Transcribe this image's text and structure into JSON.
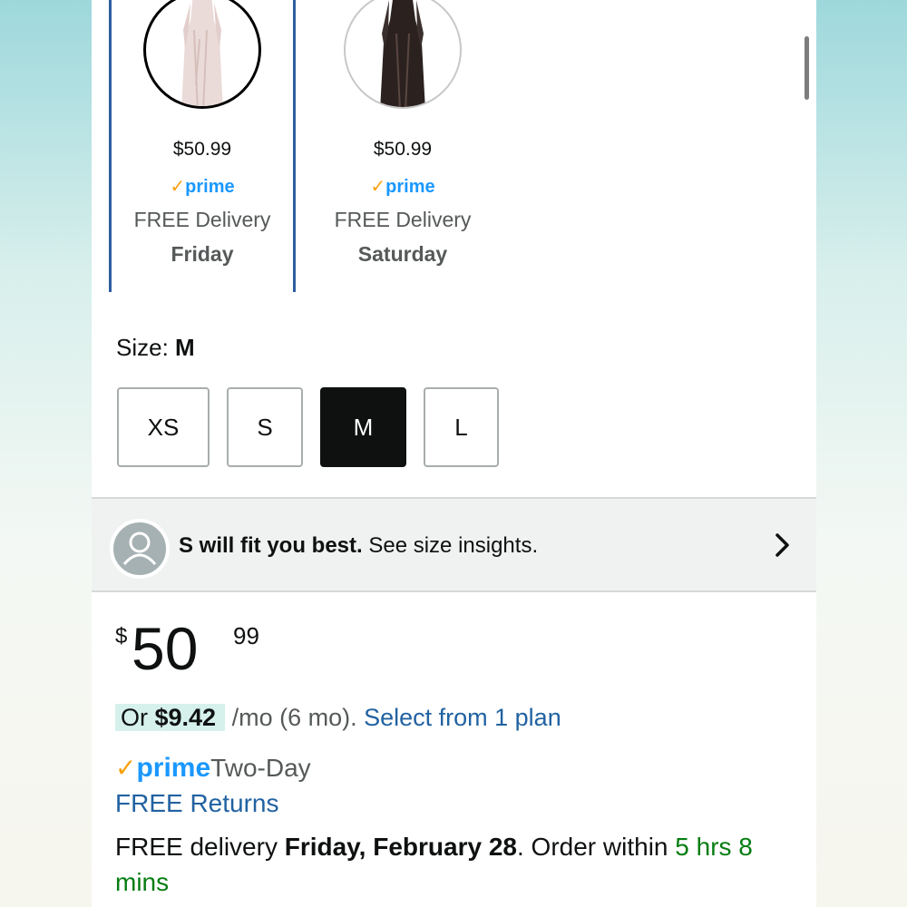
{
  "swatches": [
    {
      "name": "white-lace",
      "price": "$50.99",
      "prime_check": "✓",
      "prime": "prime",
      "delivery": "FREE Delivery",
      "day": "Friday",
      "selected": true
    },
    {
      "name": "black-lace",
      "price": "$50.99",
      "prime_check": "✓",
      "prime": "prime",
      "delivery": "FREE Delivery",
      "day": "Saturday",
      "selected": false
    }
  ],
  "size": {
    "label_prefix": "Size: ",
    "selected": "M",
    "options": [
      "XS",
      "S",
      "M",
      "L"
    ]
  },
  "insight": {
    "bold": "S will fit you best.",
    "rest": " See size insights.",
    "icon": "avatar-icon",
    "chevron": "chevron-right-icon"
  },
  "price": {
    "currency": "$",
    "whole": "50",
    "fraction": "99"
  },
  "plan": {
    "or": "Or ",
    "amount": "$9.42",
    "term": " /mo (6 mo). ",
    "link": "Select from 1 plan"
  },
  "prime": {
    "check": "✓",
    "word": "prime",
    "label": "Two-Day"
  },
  "returns": "FREE Returns",
  "delivery": {
    "prefix": "FREE delivery ",
    "date": "Friday, February 28",
    "middle": ". Order within ",
    "countdown": "5 hrs 8 mins"
  },
  "colors": {
    "accent_link": "#2162a1",
    "prime_blue": "#1a98ff",
    "prime_check": "#f7a00f",
    "countdown_green": "#067d12",
    "selected_border": "#2e5d9f"
  }
}
